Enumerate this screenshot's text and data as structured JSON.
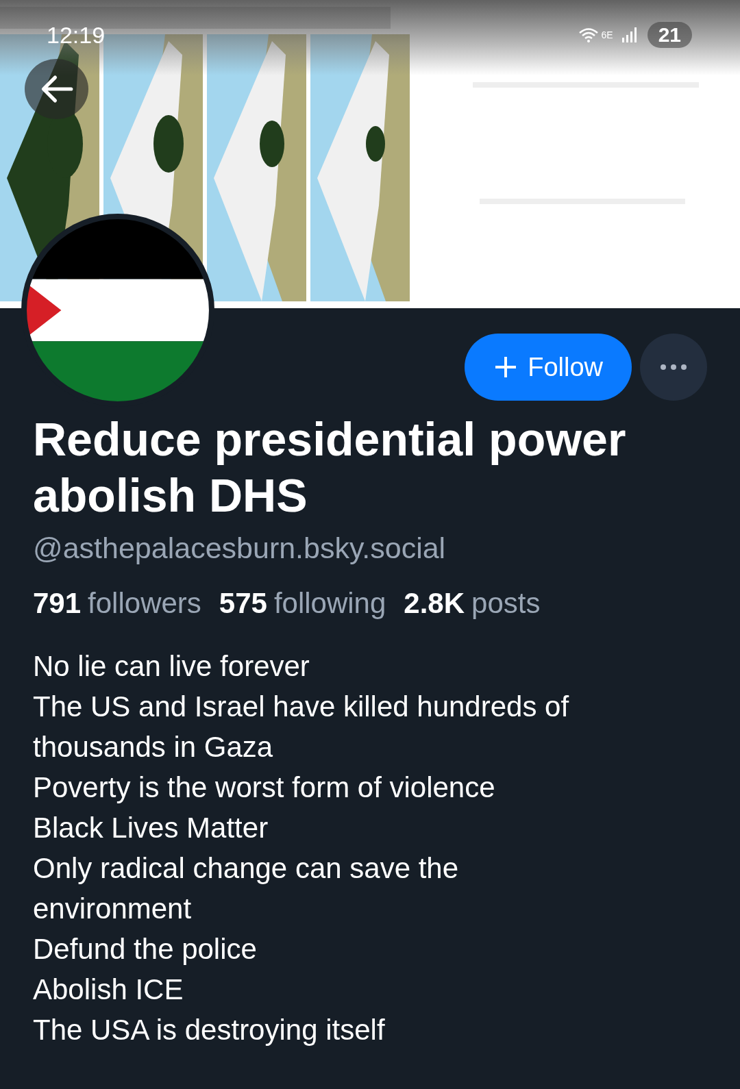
{
  "status_bar": {
    "time": "12:19",
    "network": "6E",
    "battery": "21"
  },
  "follow_button": {
    "label": "Follow"
  },
  "profile": {
    "name": "Reduce presidential power abolish DHS",
    "handle": "@asthepalacesburn.bsky.social"
  },
  "stats": [
    {
      "count": "791",
      "label": "followers"
    },
    {
      "count": "575",
      "label": "following"
    },
    {
      "count": "2.8K",
      "label": "posts"
    }
  ],
  "bio": [
    "No lie can live forever",
    "The US and Israel have killed hundreds of thousands in Gaza",
    "Poverty is the worst form of violence",
    "Black Lives Matter",
    "Only radical change can save the environment",
    "Defund the police",
    "Abolish ICE",
    "The USA is destroying itself"
  ]
}
